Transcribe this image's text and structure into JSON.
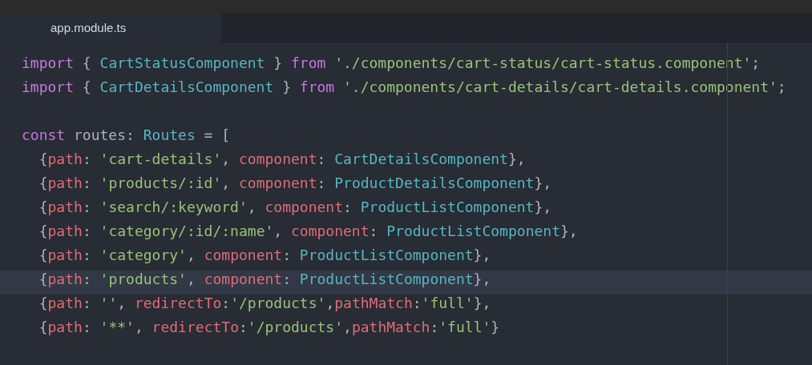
{
  "tabs": [
    {
      "label": "app.module.ts",
      "selected": true
    }
  ],
  "editor": {
    "lines": [
      {
        "current": false,
        "tokens": [
          {
            "kind": "keyword",
            "text": "import"
          },
          {
            "kind": "punct",
            "text": " { "
          },
          {
            "kind": "type",
            "text": "CartStatusComponent"
          },
          {
            "kind": "punct",
            "text": " } "
          },
          {
            "kind": "keyword",
            "text": "from "
          },
          {
            "kind": "string",
            "text": "'./components/cart-status/cart-status.component'"
          },
          {
            "kind": "punct",
            "text": ";"
          }
        ]
      },
      {
        "current": false,
        "tokens": [
          {
            "kind": "keyword",
            "text": "import"
          },
          {
            "kind": "punct",
            "text": " { "
          },
          {
            "kind": "type",
            "text": "CartDetailsComponent"
          },
          {
            "kind": "punct",
            "text": " } "
          },
          {
            "kind": "keyword",
            "text": "from "
          },
          {
            "kind": "string",
            "text": "'./components/cart-details/cart-details.component'"
          },
          {
            "kind": "punct",
            "text": ";"
          }
        ]
      },
      {
        "current": false
      },
      {
        "current": false,
        "tokens": [
          {
            "kind": "keyword",
            "text": "const"
          },
          {
            "kind": "punct",
            "text": " routes: "
          },
          {
            "kind": "type",
            "text": "Routes"
          },
          {
            "kind": "punct",
            "text": " = ["
          }
        ]
      },
      {
        "current": false,
        "tokens": [
          {
            "kind": "punct",
            "text": "  {"
          },
          {
            "kind": "property",
            "text": "path"
          },
          {
            "kind": "punct",
            "text": ": "
          },
          {
            "kind": "string",
            "text": "'cart-details'"
          },
          {
            "kind": "punct",
            "text": ", "
          },
          {
            "kind": "property",
            "text": "component"
          },
          {
            "kind": "punct",
            "text": ": "
          },
          {
            "kind": "type",
            "text": "CartDetailsComponent"
          },
          {
            "kind": "punct",
            "text": "},"
          }
        ]
      },
      {
        "current": false,
        "tokens": [
          {
            "kind": "punct",
            "text": "  {"
          },
          {
            "kind": "property",
            "text": "path"
          },
          {
            "kind": "punct",
            "text": ": "
          },
          {
            "kind": "string",
            "text": "'products/:id'"
          },
          {
            "kind": "punct",
            "text": ", "
          },
          {
            "kind": "property",
            "text": "component"
          },
          {
            "kind": "punct",
            "text": ": "
          },
          {
            "kind": "type",
            "text": "ProductDetailsComponent"
          },
          {
            "kind": "punct",
            "text": "},"
          }
        ]
      },
      {
        "current": false,
        "tokens": [
          {
            "kind": "punct",
            "text": "  {"
          },
          {
            "kind": "property",
            "text": "path"
          },
          {
            "kind": "punct",
            "text": ": "
          },
          {
            "kind": "string",
            "text": "'search/:keyword'"
          },
          {
            "kind": "punct",
            "text": ", "
          },
          {
            "kind": "property",
            "text": "component"
          },
          {
            "kind": "punct",
            "text": ": "
          },
          {
            "kind": "type",
            "text": "ProductListComponent"
          },
          {
            "kind": "punct",
            "text": "},"
          }
        ]
      },
      {
        "current": false,
        "tokens": [
          {
            "kind": "punct",
            "text": "  {"
          },
          {
            "kind": "property",
            "text": "path"
          },
          {
            "kind": "punct",
            "text": ": "
          },
          {
            "kind": "string",
            "text": "'category/:id/:name'"
          },
          {
            "kind": "punct",
            "text": ", "
          },
          {
            "kind": "property",
            "text": "component"
          },
          {
            "kind": "punct",
            "text": ": "
          },
          {
            "kind": "type",
            "text": "ProductListComponent"
          },
          {
            "kind": "punct",
            "text": "},"
          }
        ]
      },
      {
        "current": false,
        "tokens": [
          {
            "kind": "punct",
            "text": "  {"
          },
          {
            "kind": "property",
            "text": "path"
          },
          {
            "kind": "punct",
            "text": ": "
          },
          {
            "kind": "string",
            "text": "'category'"
          },
          {
            "kind": "punct",
            "text": ", "
          },
          {
            "kind": "property",
            "text": "component"
          },
          {
            "kind": "punct",
            "text": ": "
          },
          {
            "kind": "type",
            "text": "ProductListComponent"
          },
          {
            "kind": "punct",
            "text": "},"
          }
        ]
      },
      {
        "current": true,
        "tokens": [
          {
            "kind": "punct",
            "text": "  {"
          },
          {
            "kind": "property",
            "text": "path"
          },
          {
            "kind": "punct",
            "text": ": "
          },
          {
            "kind": "string",
            "text": "'products'"
          },
          {
            "kind": "punct",
            "text": ", "
          },
          {
            "kind": "property",
            "text": "component"
          },
          {
            "kind": "punct",
            "text": ": "
          },
          {
            "kind": "type",
            "text": "ProductListComponent"
          },
          {
            "kind": "punct",
            "text": "},"
          }
        ]
      },
      {
        "current": false,
        "tokens": [
          {
            "kind": "punct",
            "text": "  {"
          },
          {
            "kind": "property",
            "text": "path"
          },
          {
            "kind": "punct",
            "text": ": "
          },
          {
            "kind": "string",
            "text": "''"
          },
          {
            "kind": "punct",
            "text": ", "
          },
          {
            "kind": "property",
            "text": "redirectTo"
          },
          {
            "kind": "punct",
            "text": ":"
          },
          {
            "kind": "string",
            "text": "'/products'"
          },
          {
            "kind": "punct",
            "text": ","
          },
          {
            "kind": "property",
            "text": "pathMatch"
          },
          {
            "kind": "punct",
            "text": ":"
          },
          {
            "kind": "string",
            "text": "'full'"
          },
          {
            "kind": "punct",
            "text": "},"
          }
        ]
      },
      {
        "current": false,
        "tokens": [
          {
            "kind": "punct",
            "text": "  {"
          },
          {
            "kind": "property",
            "text": "path"
          },
          {
            "kind": "punct",
            "text": ": "
          },
          {
            "kind": "string",
            "text": "'**'"
          },
          {
            "kind": "punct",
            "text": ", "
          },
          {
            "kind": "property",
            "text": "redirectTo"
          },
          {
            "kind": "punct",
            "text": ":"
          },
          {
            "kind": "string",
            "text": "'/products'"
          },
          {
            "kind": "punct",
            "text": ","
          },
          {
            "kind": "property",
            "text": "pathMatch"
          },
          {
            "kind": "punct",
            "text": ":"
          },
          {
            "kind": "string",
            "text": "'full'"
          },
          {
            "kind": "punct",
            "text": "}"
          }
        ]
      }
    ]
  }
}
